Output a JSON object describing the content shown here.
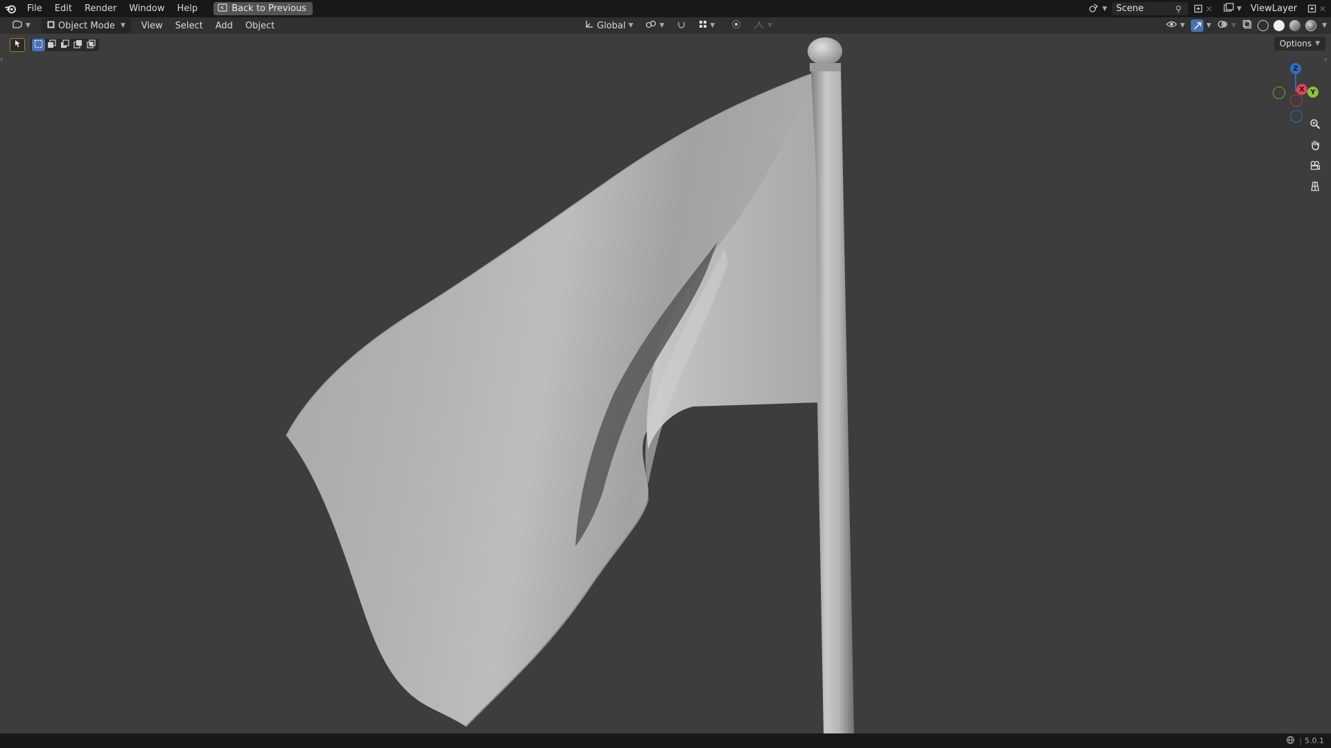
{
  "menu": {
    "items": [
      "File",
      "Edit",
      "Render",
      "Window",
      "Help"
    ],
    "back_button": "Back to Previous"
  },
  "top_right": {
    "scene_name": "Scene",
    "view_layer": "ViewLayer"
  },
  "header": {
    "mode": "Object Mode",
    "menus": [
      "View",
      "Select",
      "Add",
      "Object"
    ],
    "transform_orientation": "Global"
  },
  "viewport": {
    "options_label": "Options",
    "gizmo": {
      "x": "X",
      "y": "Y",
      "z": "Z"
    },
    "background_color": "#3d3d3d"
  },
  "status": {
    "version": "5.0.1"
  },
  "icons": [
    "blender-logo-icon",
    "back-icon",
    "editor-type-icon",
    "object-mode-icon",
    "transform-orientation-icon",
    "pivot-icon",
    "snap-icon",
    "proportional-edit-icon",
    "visibility-icon",
    "gizmo-icon",
    "overlay-icon",
    "xray-icon",
    "wireframe-shading-icon",
    "solid-shading-icon",
    "material-shading-icon",
    "rendered-shading-icon",
    "zoom-icon",
    "hand-pan-icon",
    "camera-icon",
    "grid-view-icon",
    "globe-icon"
  ]
}
